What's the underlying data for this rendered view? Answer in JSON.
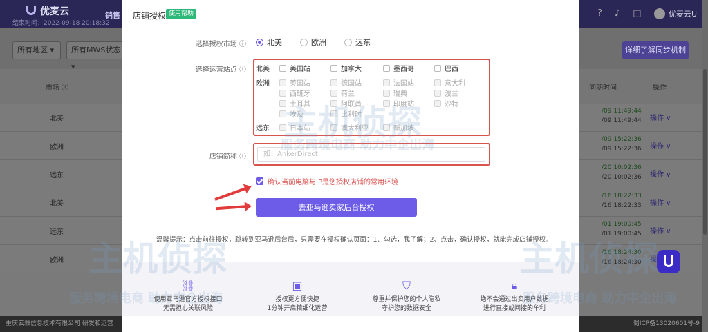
{
  "app": {
    "brand": "优麦云",
    "sub_info": "结束时间：2022-09-18 20:18:32",
    "nav_partial": "销售",
    "user_name": "优麦云U"
  },
  "filters": {
    "region": "所有地区",
    "mws_status": "所有MWS状态",
    "detail_btn": "详细了解同步机制"
  },
  "table": {
    "col_market": "市场 ⓘ",
    "col_time": "同期时间",
    "col_op": "操作",
    "rows": [
      {
        "market": "北美",
        "t1": "/09 11:49:44",
        "t2": "/09 11:49:44",
        "op": "操作"
      },
      {
        "market": "欧洲",
        "t1": "/09 15:22:36",
        "t2": "/09 15:22:36",
        "op": "操作"
      },
      {
        "market": "远东",
        "t1": "/20 10:02:36",
        "t2": "/20 10:02:36",
        "op": "操作"
      },
      {
        "market": "北美",
        "t1": "/16 18:22:33",
        "t2": "/16 18:22:33",
        "op": "操作"
      },
      {
        "market": "远东",
        "t1": "/01 19:00:45",
        "t2": "/01 19:00:45",
        "op": "操作"
      },
      {
        "market": "欧洲",
        "t1": "/16 18:24:30",
        "t2": "/16 18:24:30",
        "op": "操作"
      }
    ]
  },
  "footer": {
    "left": "重庆云雅信息技术有限公司 研发和运营",
    "right": "蜀ICP备13020601号-9"
  },
  "modal": {
    "title": "店铺授权",
    "help_tag": "使用帮助",
    "market_label": "选择授权市场 ⓘ",
    "markets": [
      "北美",
      "欧洲",
      "远东"
    ],
    "selected_market": "北美",
    "site_label": "选择运营站点 ⓘ",
    "regions": {
      "na": {
        "name": "北美",
        "sites": [
          "美国站",
          "加拿大",
          "墨西哥",
          "巴西"
        ]
      },
      "eu": {
        "name": "欧洲",
        "sites": [
          "英国站",
          "德国站",
          "法国站",
          "意大利",
          "西班牙",
          "荷兰",
          "瑞典",
          "波兰",
          "土耳其",
          "阿联酋",
          "印度站",
          "沙特",
          "埃及",
          "比利时"
        ]
      },
      "fe": {
        "name": "远东",
        "sites": [
          "日本站",
          "澳大利亚",
          "新加坡"
        ]
      }
    },
    "store_label": "店铺简称 ⓘ",
    "store_placeholder": "如：AnkerDirect",
    "confirm_text": "确认当前电脑与IP是您授权店铺的常用环境",
    "auth_button": "去亚马逊卖家后台授权",
    "tip": "温馨提示：点击前往授权，跳转到亚马逊后台后，只需要在授权确认页面：1、勾选，我了解；2、点击，确认授权，就能完成店铺授权。",
    "features": [
      {
        "icon": "link-icon",
        "line1": "使用亚马逊官方授权接口",
        "line2": "无需担心关联风险"
      },
      {
        "icon": "chart-icon",
        "line1": "授权更方便快捷",
        "line2": "1分钟开启精细化运营"
      },
      {
        "icon": "shield-icon",
        "line1": "尊重并保护您的个人隐私",
        "line2": "守护您的数据安全"
      },
      {
        "icon": "lock-icon",
        "line1": "绝不会通过出卖用户数据",
        "line2": "进行直接或间接的牟利"
      }
    ]
  },
  "watermark": {
    "text": "主机侦探",
    "slogan": "服务跨境电商 助力中企出海"
  },
  "colors": {
    "accent": "#6c5ce7",
    "warning_red": "#d9534f",
    "help_green": "#2eb87a"
  }
}
